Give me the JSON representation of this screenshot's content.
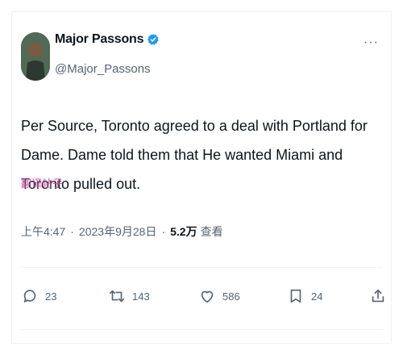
{
  "author": {
    "name": "Major Passons",
    "handle": "@Major_Passons"
  },
  "tweet": {
    "text": "Per Source, Toronto agreed to a deal with Portland for Dame. Dame told them that He wanted Miami and Toronto pulled out.",
    "translate_label": "翻译帖子"
  },
  "meta": {
    "time": "上午4:47",
    "date": "2023年9月28日",
    "views_count": "5.2万",
    "views_label": "查看"
  },
  "actions": {
    "replies": "23",
    "retweets": "143",
    "likes": "586",
    "bookmarks": "24"
  },
  "colors": {
    "verified": "#1d9bf0",
    "translate": "#c64ca0",
    "muted": "#536471"
  }
}
